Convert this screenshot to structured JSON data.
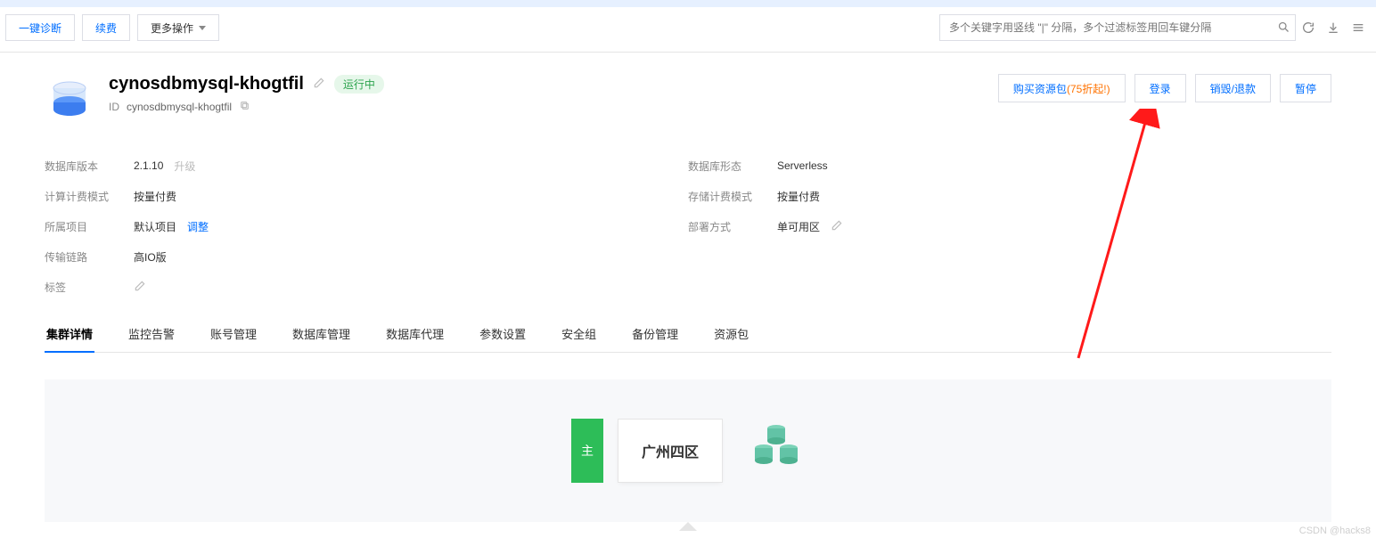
{
  "toolbar": {
    "diagnose": "一键诊断",
    "renew": "续费",
    "more": "更多操作",
    "search_placeholder": "多个关键字用竖线 \"|\" 分隔，多个过滤标签用回车键分隔"
  },
  "header": {
    "title": "cynosdbmysql-khogtfil",
    "status": "运行中",
    "id_label": "ID",
    "id_value": "cynosdbmysql-khogtfil"
  },
  "actions": {
    "buy": "购买资源包",
    "discount": "(75折起!)",
    "login": "登录",
    "destroy": "销毁/退款",
    "pause": "暂停"
  },
  "info_left": {
    "version_label": "数据库版本",
    "version_value": "2.1.10",
    "upgrade": "升级",
    "compute_mode_label": "计算计费模式",
    "compute_mode_value": "按量付费",
    "project_label": "所属项目",
    "project_value": "默认项目",
    "project_adjust": "调整",
    "link_label": "传输链路",
    "link_value": "高IO版",
    "tag_label": "标签"
  },
  "info_right": {
    "form_label": "数据库形态",
    "form_value": "Serverless",
    "storage_mode_label": "存储计费模式",
    "storage_mode_value": "按量付费",
    "deploy_label": "部署方式",
    "deploy_value": "单可用区"
  },
  "tabs": {
    "items": [
      {
        "label": "集群详情",
        "active": true
      },
      {
        "label": "监控告警"
      },
      {
        "label": "账号管理"
      },
      {
        "label": "数据库管理"
      },
      {
        "label": "数据库代理"
      },
      {
        "label": "参数设置"
      },
      {
        "label": "安全组"
      },
      {
        "label": "备份管理"
      },
      {
        "label": "资源包"
      }
    ]
  },
  "panel": {
    "role": "主",
    "zone": "广州四区"
  },
  "watermark": "CSDN @hacks8"
}
